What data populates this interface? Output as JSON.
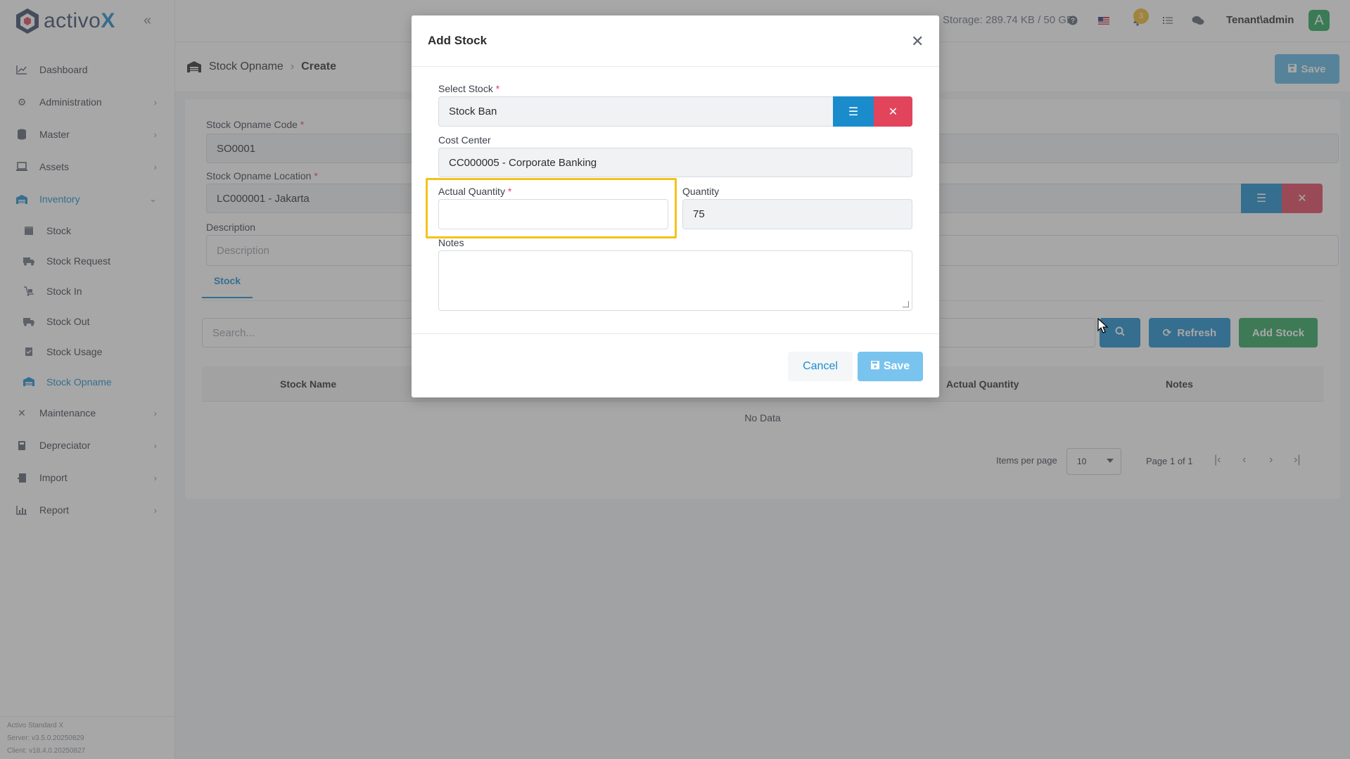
{
  "app": {
    "logo_text": "activo",
    "logo_x": "X",
    "storage": "Storage: 289.74 KB / 50 GB",
    "notification_count": "3",
    "user": "Tenant\\admin",
    "avatar_letter": "A"
  },
  "sidebar": {
    "items": [
      {
        "label": "Dashboard",
        "icon": "chart-line-icon"
      },
      {
        "label": "Administration",
        "icon": "cogs-icon"
      },
      {
        "label": "Master",
        "icon": "database-icon"
      },
      {
        "label": "Assets",
        "icon": "laptop-icon"
      },
      {
        "label": "Inventory",
        "icon": "warehouse-icon"
      }
    ],
    "inventory_sub": [
      {
        "label": "Stock"
      },
      {
        "label": "Stock Request"
      },
      {
        "label": "Stock In"
      },
      {
        "label": "Stock Out"
      },
      {
        "label": "Stock Usage"
      },
      {
        "label": "Stock Opname"
      }
    ],
    "items_after": [
      {
        "label": "Maintenance"
      },
      {
        "label": "Depreciator"
      },
      {
        "label": "Import"
      },
      {
        "label": "Report"
      }
    ],
    "footer": {
      "product": "Activo Standard X",
      "server": "Server: v3.5.0.20250829",
      "client": "Client: v18.4.0.20250827"
    }
  },
  "page": {
    "breadcrumb_parent": "Stock Opname",
    "breadcrumb_current": "Create",
    "save_label": "Save"
  },
  "form": {
    "code_label": "Stock Opname Code",
    "code_value": "SO0001",
    "location_label": "Stock Opname Location",
    "location_value": "LC000001 - Jakarta",
    "description_label": "Description",
    "description_placeholder": "Description",
    "tab_stock": "Stock",
    "search_placeholder": "Search...",
    "refresh_label": "Refresh",
    "add_stock_label": "Add Stock",
    "columns": [
      "Stock Name",
      "Actual Quantity",
      "Notes"
    ],
    "no_data": "No Data",
    "items_per_page_label": "Items per page",
    "items_per_page_value": "10",
    "page_info": "Page 1 of 1"
  },
  "modal": {
    "title": "Add Stock",
    "select_stock_label": "Select Stock",
    "select_stock_value": "Stock Ban",
    "cost_center_label": "Cost Center",
    "cost_center_value": "CC000005 - Corporate Banking",
    "actual_quantity_label": "Actual Quantity",
    "actual_quantity_value": "",
    "quantity_label": "Quantity",
    "quantity_value": "75",
    "notes_label": "Notes",
    "notes_value": "",
    "cancel_label": "Cancel",
    "save_label": "Save"
  },
  "colors": {
    "primary": "#1a8ccc",
    "danger": "#e2445c",
    "success": "#2aa55a",
    "highlight": "#f5c21b"
  }
}
